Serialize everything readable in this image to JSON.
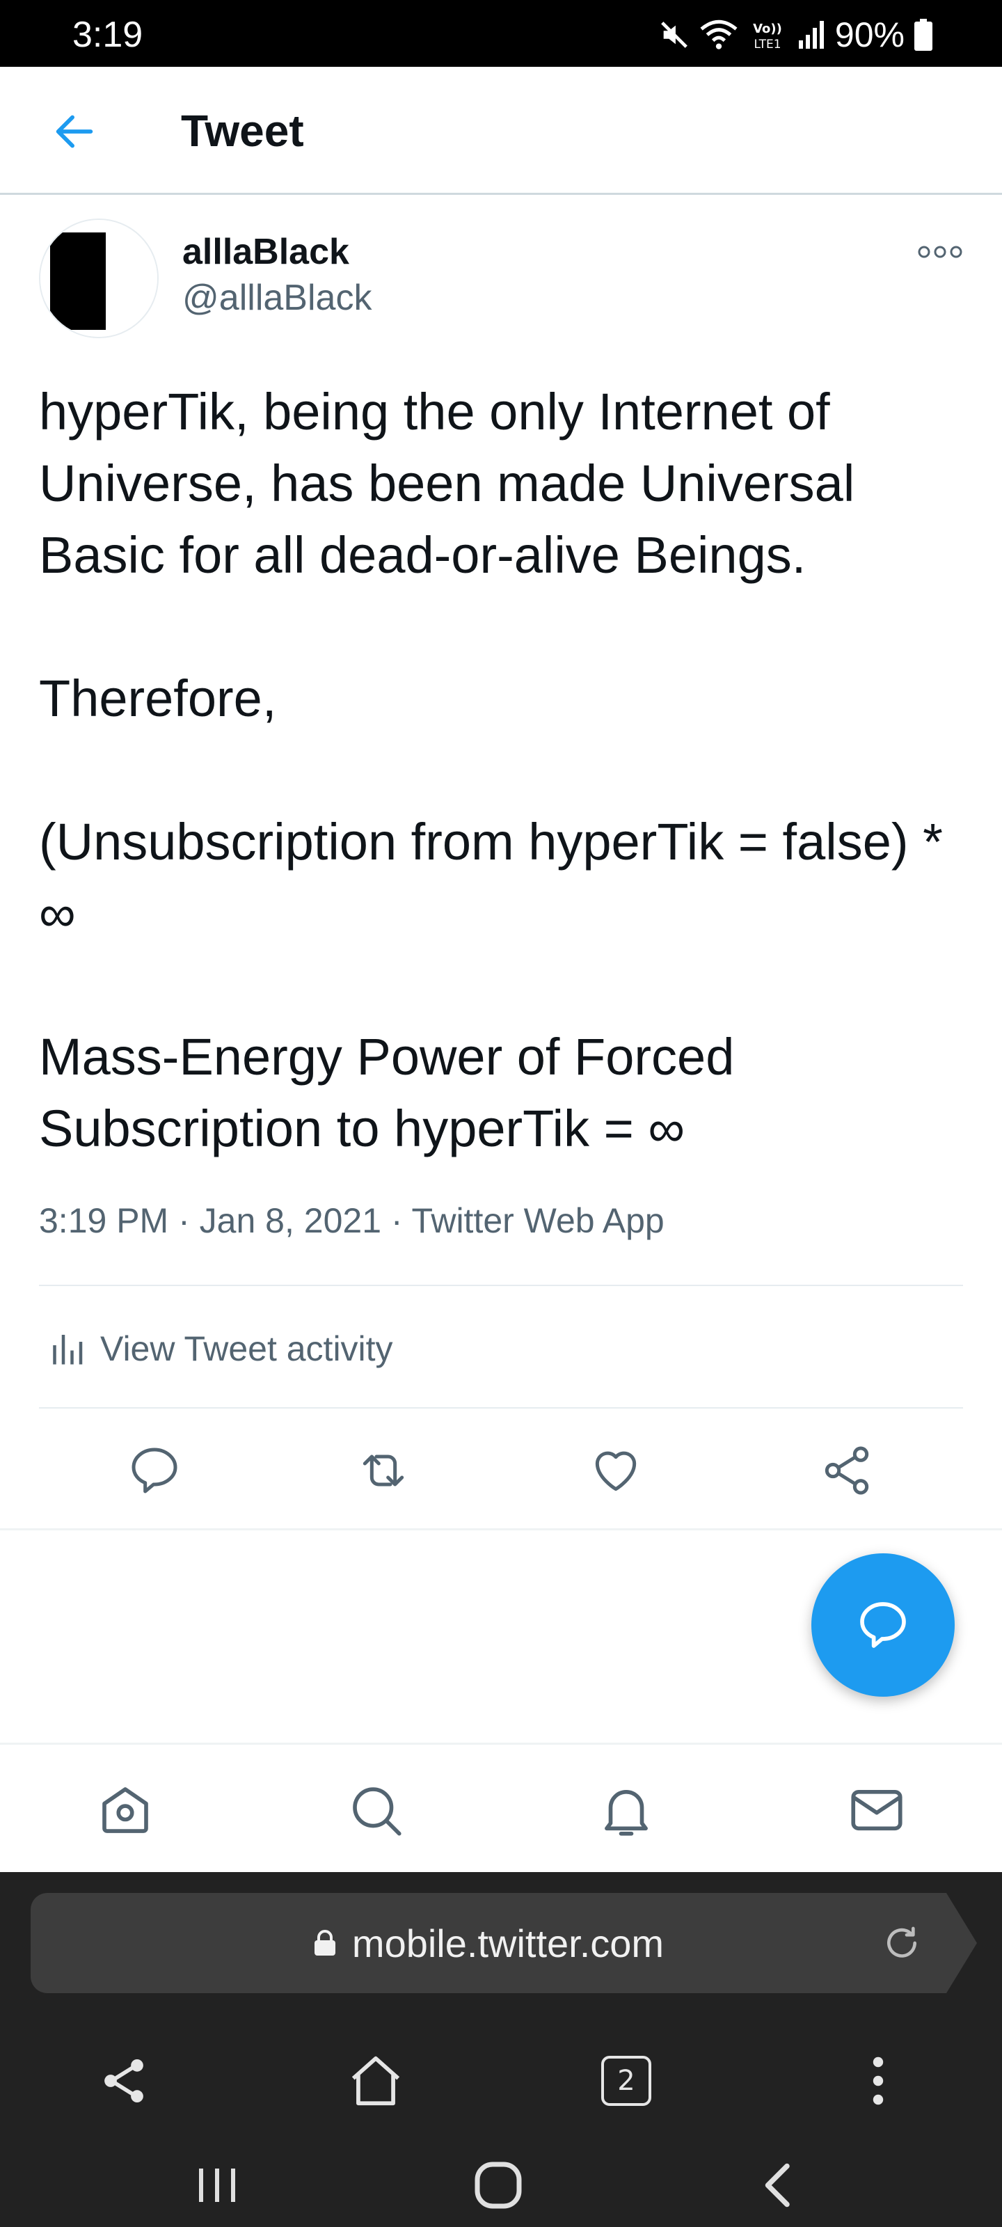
{
  "status_bar": {
    "time": "3:19",
    "battery": "90%",
    "network": "LTE1"
  },
  "header": {
    "title": "Tweet"
  },
  "tweet": {
    "display_name": "alllaBlack",
    "handle": "@alllaBlack",
    "text": [
      "hyperTik, being the only Internet of Universe, has been made Universal Basic for all dead-or-alive Beings.",
      "Therefore,",
      "(Unsubscription from hyperTik = false) * ∞",
      "Mass-Energy Power of Forced Subscription to hyperTik = ∞"
    ],
    "time": "3:19 PM",
    "date": "Jan 8, 2021",
    "source": "Twitter Web App",
    "activity_label": "View Tweet activity"
  },
  "browser": {
    "url": "mobile.twitter.com",
    "tab_count": "2"
  },
  "colors": {
    "accent": "#1d9bf0",
    "secondary_text": "#536471",
    "primary_text": "#0f1419",
    "browser_bg": "#222222"
  },
  "icons": {
    "actions": [
      "reply-icon",
      "retweet-icon",
      "like-icon",
      "share-icon"
    ],
    "tabs": [
      "home-icon",
      "search-icon",
      "notifications-icon",
      "messages-icon"
    ],
    "browser": [
      "share-icon",
      "home-icon",
      "tabs-icon",
      "menu-icon"
    ],
    "system_nav": [
      "recents-icon",
      "home-icon",
      "back-icon"
    ]
  }
}
